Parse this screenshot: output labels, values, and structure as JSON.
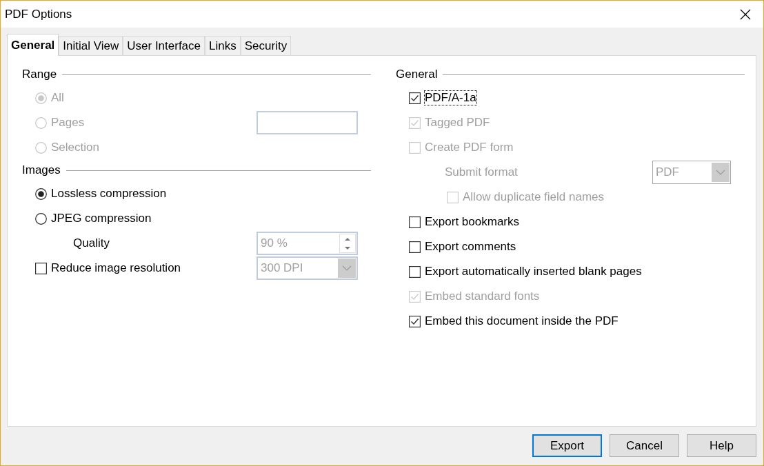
{
  "window": {
    "title": "PDF Options"
  },
  "tabs": [
    {
      "label": "General",
      "selected": true
    },
    {
      "label": "Initial View",
      "selected": false
    },
    {
      "label": "User Interface",
      "selected": false
    },
    {
      "label": "Links",
      "selected": false
    },
    {
      "label": "Security",
      "selected": false
    }
  ],
  "range": {
    "title": "Range",
    "options": [
      {
        "label": "All",
        "selected": true,
        "disabled": true,
        "kind": "plain"
      },
      {
        "label": "Pages",
        "selected": false,
        "disabled": true,
        "kind": "field"
      },
      {
        "label": "Selection",
        "selected": false,
        "disabled": true,
        "kind": "plain"
      }
    ]
  },
  "images": {
    "title": "Images",
    "rows": [
      {
        "kind": "radio",
        "label": "Lossless compression",
        "selected": true,
        "disabled": false
      },
      {
        "kind": "radio",
        "label": "JPEG compression",
        "selected": false,
        "disabled": false
      },
      {
        "kind": "spin",
        "label": "Quality",
        "value": "90 %",
        "disabled": true
      },
      {
        "kind": "checkbox",
        "label": "Reduce image resolution",
        "checked": false,
        "disabled": false,
        "dropdown": {
          "value": "300 DPI",
          "disabled": true
        }
      }
    ]
  },
  "general": {
    "title": "General",
    "items": [
      {
        "kind": "checkbox",
        "label": "PDF/A-1a",
        "checked": true,
        "disabled": false,
        "focused": true
      },
      {
        "kind": "checkbox",
        "label": "Tagged PDF",
        "checked": true,
        "disabled": true
      },
      {
        "kind": "checkbox",
        "label": "Create PDF form",
        "checked": false,
        "disabled": true,
        "children": [
          {
            "kind": "dropdown",
            "label": "Submit format",
            "value": "PDF",
            "disabled": true
          },
          {
            "kind": "checkbox",
            "label": "Allow duplicate field names",
            "checked": false,
            "disabled": true
          }
        ]
      },
      {
        "kind": "checkbox",
        "label": "Export bookmarks",
        "checked": false,
        "disabled": false
      },
      {
        "kind": "checkbox",
        "label": "Export comments",
        "checked": false,
        "disabled": false
      },
      {
        "kind": "checkbox",
        "label": "Export automatically inserted blank pages",
        "checked": false,
        "disabled": false
      },
      {
        "kind": "checkbox",
        "label": "Embed standard fonts",
        "checked": true,
        "disabled": true
      },
      {
        "kind": "checkbox",
        "label": "Embed this document inside the PDF",
        "checked": true,
        "disabled": false
      }
    ]
  },
  "buttons": [
    {
      "label": "Export",
      "default": true
    },
    {
      "label": "Cancel",
      "default": false
    },
    {
      "label": "Help",
      "default": false
    }
  ]
}
